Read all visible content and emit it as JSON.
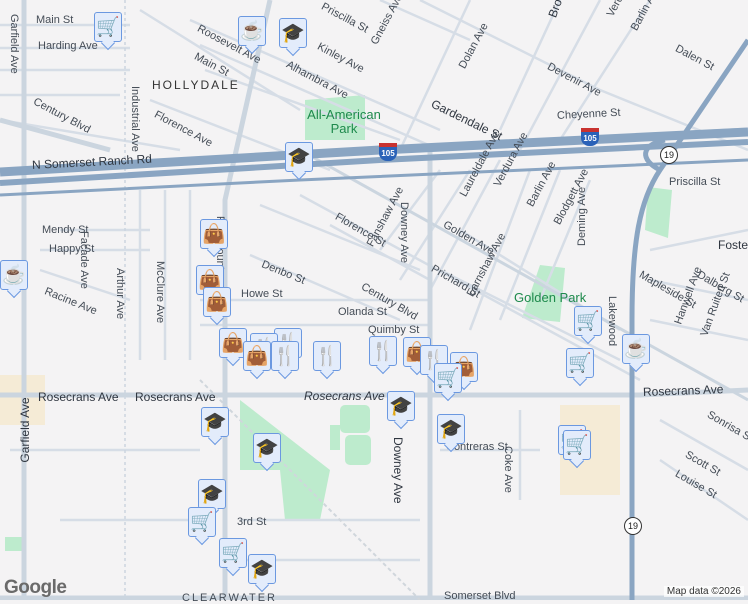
{
  "labels": [
    "Main St",
    "Harding Ave",
    "Garfield Ave",
    "Industrial Ave",
    "HOLLYDALE",
    "Century Blvd",
    "Florence Ave",
    "Roosevelt Ave",
    "Main St",
    "Alhambra Ave",
    "Kinley Ave",
    "Priscilla St",
    "Gneiss Ave",
    "N Somerset Ranch Rd",
    "Mendy St",
    "Happy St",
    "Facade Ave",
    "Arthur Ave",
    "McClure Ave",
    "Racine Ave",
    "Denbo St",
    "Howe St",
    "Florence St",
    "Fanshaw Ave",
    "Century Blvd",
    "Olanda St",
    "Quimby St",
    "Gardendale St",
    "Dolan Ave",
    "Devenir Ave",
    "Dalen St",
    "Barlin Ave",
    "Cheyenne St",
    "Downey Ave",
    "Laureldale Ave",
    "Verdura Ave",
    "Golden Ave",
    "Barlin Ave",
    "Blodgett Ave",
    "Deming Ave",
    "Priscilla St",
    "Foster",
    "Prichard St",
    "Earnshaw Ave",
    "Mapleside St",
    "Dalberg St",
    "Hanwell Ave",
    "Van Ruiten St",
    "Lakewood",
    "Rosecrans Ave",
    "Rosecrans Ave",
    "Rosecrans Ave",
    "Rosecrans Ave",
    "Downey Ave",
    "Contreras St",
    "Coke Ave",
    "Scott St",
    "Louise St",
    "Sonrisa St",
    "Garfield Ave",
    "3rd St",
    "Somerset Blvd",
    "CLEARWATER",
    "Paramount",
    "Brookshire",
    "Verdura"
  ],
  "parks": {
    "all_american": "All-American Park",
    "golden": "Golden Park"
  },
  "shields": {
    "i105_a": "105",
    "i105_b": "105",
    "sr19_a": "19",
    "sr19_b": "19"
  },
  "markers": [
    {
      "type": "cart-icon",
      "glyph": "🛒"
    },
    {
      "type": "coffee-icon",
      "glyph": "☕"
    },
    {
      "type": "school-icon",
      "glyph": "🎓"
    },
    {
      "type": "school-icon",
      "glyph": "🎓"
    },
    {
      "type": "coffee-icon",
      "glyph": "☕"
    },
    {
      "type": "bag-icon",
      "glyph": "👜"
    },
    {
      "type": "bag-icon",
      "glyph": "👜"
    },
    {
      "type": "bag-icon",
      "glyph": "👜"
    },
    {
      "type": "restaurant-icon",
      "glyph": "🍴"
    },
    {
      "type": "bag-icon",
      "glyph": "👜"
    },
    {
      "type": "restaurant-icon",
      "glyph": "🍴"
    },
    {
      "type": "bag-icon",
      "glyph": "👜"
    },
    {
      "type": "restaurant-icon",
      "glyph": "🍴"
    },
    {
      "type": "restaurant-icon",
      "glyph": "🍴"
    },
    {
      "type": "restaurant-icon",
      "glyph": "🍴"
    },
    {
      "type": "bag-icon",
      "glyph": "👜"
    },
    {
      "type": "restaurant-icon",
      "glyph": "🍴"
    },
    {
      "type": "bag-icon",
      "glyph": "👜"
    },
    {
      "type": "cart-icon",
      "glyph": "🛒"
    },
    {
      "type": "cart-icon",
      "glyph": "🛒"
    },
    {
      "type": "cart-icon",
      "glyph": "🛒"
    },
    {
      "type": "coffee-icon",
      "glyph": "☕"
    },
    {
      "type": "school-icon",
      "glyph": "🎓"
    },
    {
      "type": "school-icon",
      "glyph": "🎓"
    },
    {
      "type": "school-icon",
      "glyph": "🎓"
    },
    {
      "type": "school-icon",
      "glyph": "🎓"
    },
    {
      "type": "school-icon",
      "glyph": "🎓"
    },
    {
      "type": "cart-icon",
      "glyph": "🛒"
    },
    {
      "type": "cart-icon",
      "glyph": "🛒"
    },
    {
      "type": "school-icon",
      "glyph": "🎓"
    },
    {
      "type": "cart-icon",
      "glyph": "🛒"
    },
    {
      "type": "cart-icon",
      "glyph": "🛒"
    }
  ],
  "footer": {
    "logo": "Google",
    "attribution": "Map data ©2026"
  }
}
